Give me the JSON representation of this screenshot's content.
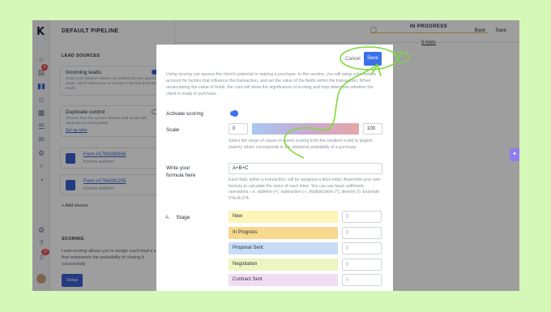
{
  "sidebar": {
    "logo": "K",
    "badges": {
      "chats": "3",
      "notifications": "27"
    }
  },
  "left_panel": {
    "title": "DEFAULT PIPELINE",
    "lead_sources_heading": "LEAD SOURCES",
    "incoming_leads": {
      "title": "Incoming leads",
      "desc": "Keep your pipeline cleaner by adding this pre-pipeline stage, which allows you to accept or decline potential leads"
    },
    "duplicate_control": {
      "title": "Duplicate control",
      "desc": "Choose how the system detects and deals with duplicate incoming leads",
      "link": "Set up rules"
    },
    "forms": [
      {
        "name": "Form #1784280658",
        "source": "Kommo webform"
      },
      {
        "name": "Form #1784281205",
        "source": "Kommo webform"
      }
    ],
    "add_source": "+ Add source",
    "scoring_heading": "SCORING",
    "scoring_desc": "Lead scoring allows you to assign each lead a value that represents the probability of closing it successfully",
    "setup_button": "Setup"
  },
  "topbar": {
    "back": "Back",
    "save": "Save"
  },
  "pipeline": {
    "stage_title": "IN PROGRESS",
    "hints": "5 hints"
  },
  "modal": {
    "cancel": "Cancel",
    "save": "Save",
    "intro": "Using scoring can assess the client's potential in making a purchase. In this section, you will setup a formula to account for factors that influence the transaction, and set the value of the fields within the transaction. When recalculating the value of fields, the card will show the significance of scoring and help determine whether the client is ready to purchase.",
    "activate_label": "Activate scoring",
    "scale_label": "Scale",
    "scale_min": "0",
    "scale_max": "100",
    "scale_help": "Select the range of values of points scoring from the smallest (cold) to largest (warm), which corresponds to the statistical probability of a purchase.",
    "formula_label_1": "Write your",
    "formula_label_2": "formula here",
    "formula_value": "A+B+C",
    "formula_help": "Each field, within a transaction, will be assigned a drive letter. Assemble your own formula to calculate the score of each letter. You can use basic arithmetic operations, i.e. addition (+), subtraction (-), Multiplication (*), division (/). Example: 5*A+B-2*A",
    "stage_letter": "A",
    "stage_label": "Stage",
    "stages": [
      {
        "name": "New",
        "value": "0",
        "color": "#fbf5b8"
      },
      {
        "name": "In Progress",
        "value": "0",
        "color": "#f6d88e"
      },
      {
        "name": "Proposal Sent",
        "value": "0",
        "color": "#c7dcf5"
      },
      {
        "name": "Negotiation",
        "value": "0",
        "color": "#edf5c2"
      },
      {
        "name": "Contract Sent",
        "value": "0",
        "color": "#f2dcf3"
      }
    ]
  },
  "colors": {
    "background": "#d5f7b8",
    "accent": "#3b71e8",
    "annotation": "#7ddc3a"
  }
}
